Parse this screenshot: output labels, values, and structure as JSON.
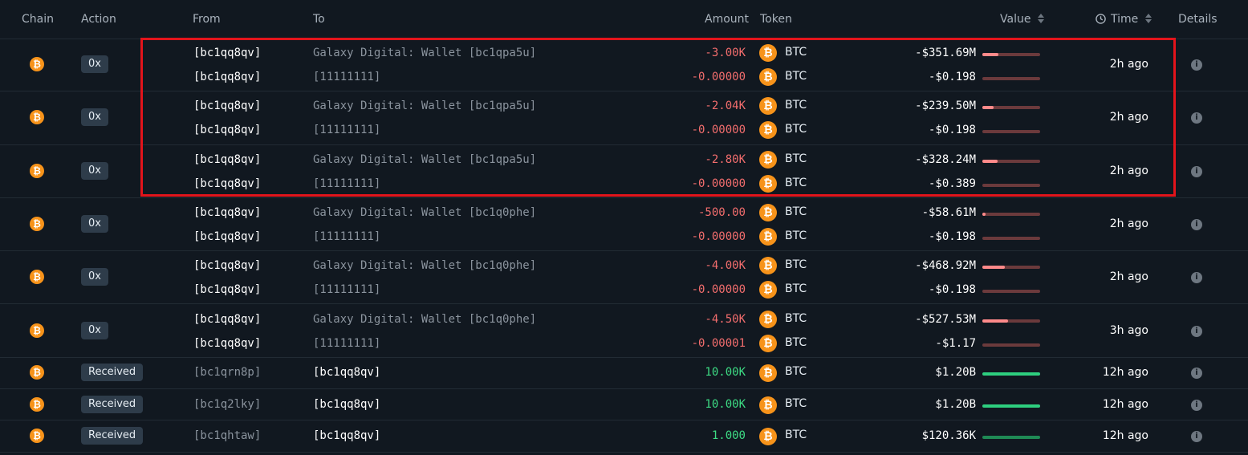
{
  "header": {
    "chain": "Chain",
    "action": "Action",
    "from": "From",
    "to": "To",
    "amount": "Amount",
    "token": "Token",
    "value": "Value",
    "time": "Time",
    "details": "Details"
  },
  "rows": [
    {
      "action": "0x",
      "time": "2h ago",
      "lines": [
        {
          "from": "[bc1qq8qv]",
          "to": "Galaxy Digital: Wallet [bc1qpa5u]",
          "amount": "-3.00K",
          "token": "BTC",
          "value": "-$351.69M",
          "bar": 0.28
        },
        {
          "from": "[bc1qq8qv]",
          "to": "[11111111]",
          "amount": "-0.00000",
          "token": "BTC",
          "value": "-$0.198",
          "bar": 0
        }
      ]
    },
    {
      "action": "0x",
      "time": "2h ago",
      "lines": [
        {
          "from": "[bc1qq8qv]",
          "to": "Galaxy Digital: Wallet [bc1qpa5u]",
          "amount": "-2.04K",
          "token": "BTC",
          "value": "-$239.50M",
          "bar": 0.19
        },
        {
          "from": "[bc1qq8qv]",
          "to": "[11111111]",
          "amount": "-0.00000",
          "token": "BTC",
          "value": "-$0.198",
          "bar": 0
        }
      ]
    },
    {
      "action": "0x",
      "time": "2h ago",
      "lines": [
        {
          "from": "[bc1qq8qv]",
          "to": "Galaxy Digital: Wallet [bc1qpa5u]",
          "amount": "-2.80K",
          "token": "BTC",
          "value": "-$328.24M",
          "bar": 0.27
        },
        {
          "from": "[bc1qq8qv]",
          "to": "[11111111]",
          "amount": "-0.00000",
          "token": "BTC",
          "value": "-$0.389",
          "bar": 0
        }
      ]
    },
    {
      "action": "0x",
      "time": "2h ago",
      "lines": [
        {
          "from": "[bc1qq8qv]",
          "to": "Galaxy Digital: Wallet [bc1q0phe]",
          "amount": "-500.00",
          "token": "BTC",
          "value": "-$58.61M",
          "bar": 0.05
        },
        {
          "from": "[bc1qq8qv]",
          "to": "[11111111]",
          "amount": "-0.00000",
          "token": "BTC",
          "value": "-$0.198",
          "bar": 0
        }
      ]
    },
    {
      "action": "0x",
      "time": "2h ago",
      "lines": [
        {
          "from": "[bc1qq8qv]",
          "to": "Galaxy Digital: Wallet [bc1q0phe]",
          "amount": "-4.00K",
          "token": "BTC",
          "value": "-$468.92M",
          "bar": 0.39
        },
        {
          "from": "[bc1qq8qv]",
          "to": "[11111111]",
          "amount": "-0.00000",
          "token": "BTC",
          "value": "-$0.198",
          "bar": 0
        }
      ]
    },
    {
      "action": "0x",
      "time": "3h ago",
      "lines": [
        {
          "from": "[bc1qq8qv]",
          "to": "Galaxy Digital: Wallet [bc1q0phe]",
          "amount": "-4.50K",
          "token": "BTC",
          "value": "-$527.53M",
          "bar": 0.44
        },
        {
          "from": "[bc1qq8qv]",
          "to": "[11111111]",
          "amount": "-0.00001",
          "token": "BTC",
          "value": "-$1.17",
          "bar": 0
        }
      ]
    }
  ],
  "received_rows": [
    {
      "action": "Received",
      "from": "[bc1qrn8p]",
      "to": "[bc1qq8qv]",
      "amount": "10.00K",
      "token": "BTC",
      "value": "$1.20B",
      "bar_color": "#2ecf7f",
      "time": "12h ago"
    },
    {
      "action": "Received",
      "from": "[bc1q2lky]",
      "to": "[bc1qq8qv]",
      "amount": "10.00K",
      "token": "BTC",
      "value": "$1.20B",
      "bar_color": "#2ecf7f",
      "time": "12h ago"
    },
    {
      "action": "Received",
      "from": "[bc1qhtaw]",
      "to": "[bc1qq8qv]",
      "amount": "1.000",
      "token": "BTC",
      "value": "$120.36K",
      "bar_color": "#1f8a55",
      "time": "12h ago"
    }
  ],
  "colors": {
    "background": "#111820",
    "negative": "#f26d6d",
    "positive": "#3ddc84",
    "btc": "#f7931a",
    "highlight": "#e3141b"
  }
}
